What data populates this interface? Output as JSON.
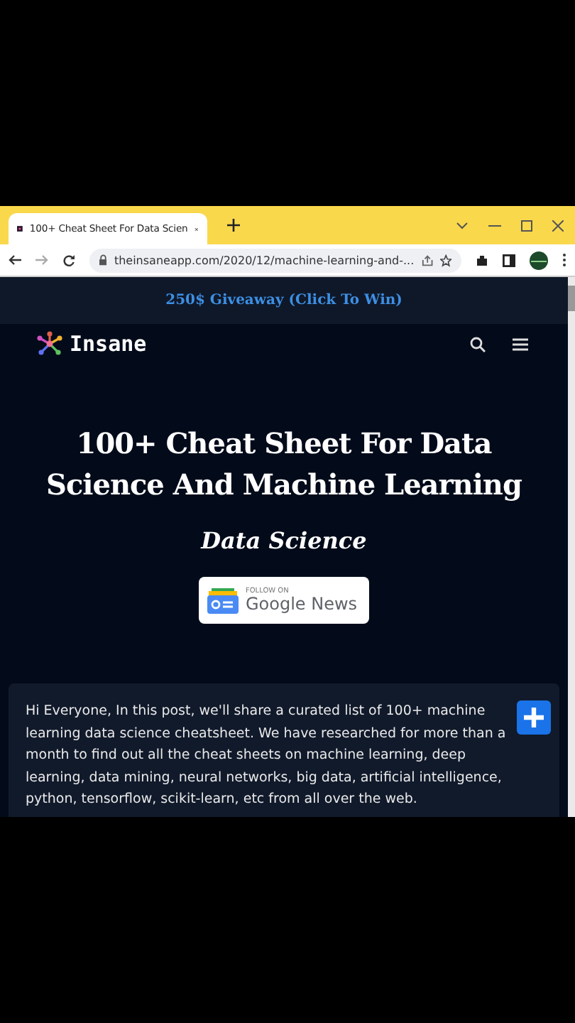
{
  "browser": {
    "tab": {
      "title": "100+ Cheat Sheet For Data Scien",
      "selected": true
    },
    "url": "theinsaneapp.com/2020/12/machine-learning-and-..."
  },
  "banner": {
    "text": "250$ Giveaway (Click To Win)"
  },
  "site": {
    "logo": "Insane"
  },
  "article": {
    "title": "100+ Cheat Sheet For Data Science And Machine Learning",
    "category": "Data Science",
    "follow": {
      "small": "FOLLOW ON",
      "brand": "Google News"
    },
    "intro": "Hi Everyone, In this post, we'll share a curated list of 100+ machine learning data science cheatsheet. We have researched for more than a month to find out all the cheat sheets on machine learning, deep learning, data mining, neural networks, big data, artificial intelligence, python, tensorflow, scikit-learn, etc from all over the web."
  }
}
